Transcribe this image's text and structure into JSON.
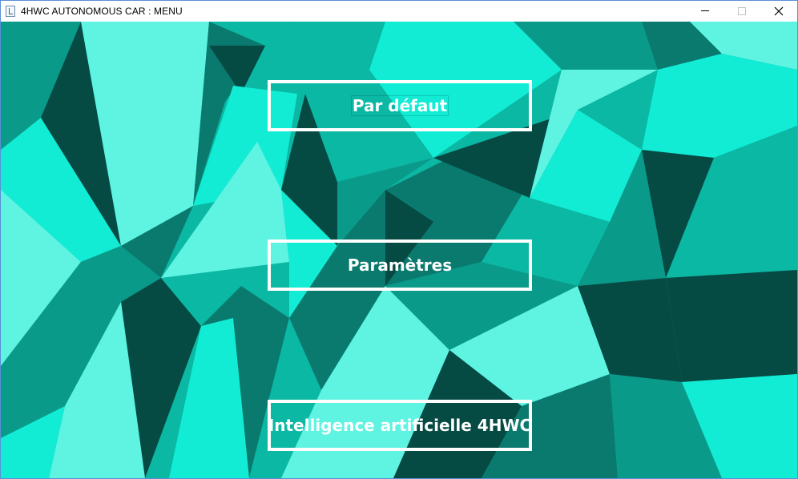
{
  "window": {
    "title": "4HWC AUTONOMOUS CAR : MENU",
    "controls": [
      "minimize-icon",
      "maximize-icon",
      "close-icon"
    ]
  },
  "menu": {
    "buttons": [
      {
        "label": "Par défaut"
      },
      {
        "label": "Paramètres"
      },
      {
        "label": "Intelligence artificielle 4HWC"
      }
    ]
  },
  "colors": {
    "dark": "#064a44",
    "deep": "#0a7a6e",
    "mid": "#0bb8a4",
    "bright": "#12ecd4",
    "pale": "#5ff3e2",
    "button_border": "#ffffff"
  }
}
